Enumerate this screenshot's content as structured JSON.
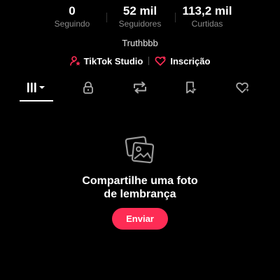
{
  "stats": {
    "following": {
      "value": "0",
      "label": "Seguindo"
    },
    "followers": {
      "value": "52 mil",
      "label": "Seguidores"
    },
    "likes": {
      "value": "113,2 mil",
      "label": "Curtidas"
    }
  },
  "profile": {
    "bio": "Truthbbb"
  },
  "links": {
    "studio_label": "TikTok Studio",
    "subscription_label": "Inscrição"
  },
  "tabs": [
    {
      "name": "videos-grid",
      "icon": "grid-icon",
      "selected": true
    },
    {
      "name": "private",
      "icon": "lock-icon",
      "selected": false
    },
    {
      "name": "reposts",
      "icon": "repost-icon",
      "selected": false
    },
    {
      "name": "favorites",
      "icon": "bookmark-icon",
      "selected": false
    },
    {
      "name": "liked",
      "icon": "heart-icon",
      "selected": false
    }
  ],
  "empty_state": {
    "icon": "photo-icon",
    "title": "Compartilhe uma foto\nde lembrança",
    "button_label": "Enviar"
  },
  "colors": {
    "background": "#000000",
    "accent": "#fe2c55",
    "secondary_text": "#8a8a8a"
  }
}
